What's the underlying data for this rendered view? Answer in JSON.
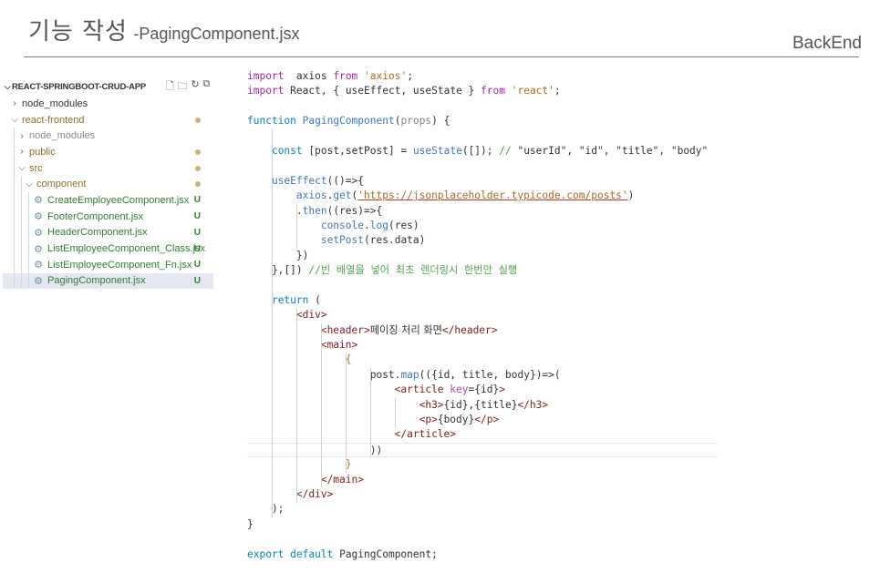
{
  "slide": {
    "title": "기능 작성",
    "subtitle": "-PagingComponent.jsx",
    "category": "BackEnd"
  },
  "explorer": {
    "project": "REACT-SPRINGBOOT-CRUD-APP",
    "items": [
      {
        "label": "node_modules",
        "indent": 1,
        "type": "folder",
        "expanded": false,
        "color": "default",
        "status": ""
      },
      {
        "label": "react-frontend",
        "indent": 1,
        "type": "folder",
        "expanded": true,
        "color": "olive",
        "status": "dot"
      },
      {
        "label": "node_modules",
        "indent": 2,
        "type": "folder",
        "expanded": false,
        "color": "gray",
        "status": ""
      },
      {
        "label": "public",
        "indent": 2,
        "type": "folder",
        "expanded": false,
        "color": "olive",
        "status": "dot"
      },
      {
        "label": "src",
        "indent": 2,
        "type": "folder",
        "expanded": true,
        "color": "olive",
        "status": "dot"
      },
      {
        "label": "component",
        "indent": 3,
        "type": "folder",
        "expanded": true,
        "color": "olive",
        "status": "dot"
      },
      {
        "label": "CreateEmployeeComponent.jsx",
        "indent": 4,
        "type": "file",
        "color": "green",
        "status": "U"
      },
      {
        "label": "FooterComponent.jsx",
        "indent": 4,
        "type": "file",
        "color": "green",
        "status": "U"
      },
      {
        "label": "HeaderComponent.jsx",
        "indent": 4,
        "type": "file",
        "color": "green",
        "status": "U"
      },
      {
        "label": "ListEmployeeComponent_Class.jsx",
        "indent": 4,
        "type": "file",
        "color": "green",
        "status": "U"
      },
      {
        "label": "ListEmployeeComponent_Fn.jsx",
        "indent": 4,
        "type": "file",
        "color": "green",
        "status": "U"
      },
      {
        "label": "PagingComponent.jsx",
        "indent": 4,
        "type": "file",
        "color": "green",
        "status": "U",
        "selected": true
      }
    ]
  },
  "code": {
    "lines": [
      [
        [
          "kw",
          "import"
        ],
        [
          "",
          "  "
        ],
        [
          "var",
          "axios"
        ],
        [
          "",
          " "
        ],
        [
          "kw",
          "from"
        ],
        [
          "",
          " "
        ],
        [
          "str",
          "'axios'"
        ],
        [
          "",
          ";"
        ]
      ],
      [
        [
          "kw",
          "import"
        ],
        [
          "",
          " "
        ],
        [
          "var",
          "React"
        ],
        [
          "",
          ", { "
        ],
        [
          "var",
          "useEffect"
        ],
        [
          "",
          ", "
        ],
        [
          "var",
          "useState"
        ],
        [
          "",
          " } "
        ],
        [
          "kw",
          "from"
        ],
        [
          "",
          " "
        ],
        [
          "str",
          "'react'"
        ],
        [
          "",
          ";"
        ]
      ],
      [],
      [
        [
          "kw2",
          "function"
        ],
        [
          "",
          " "
        ],
        [
          "fn",
          "PagingComponent"
        ],
        [
          "",
          "("
        ],
        [
          "prop",
          "props"
        ],
        [
          "",
          ") {"
        ]
      ],
      [],
      [
        [
          "",
          "    "
        ],
        [
          "kw2",
          "const"
        ],
        [
          "",
          " ["
        ],
        [
          "var",
          "post"
        ],
        [
          "",
          ","
        ],
        [
          "var",
          "setPost"
        ],
        [
          "",
          "] = "
        ],
        [
          "fn",
          "useState"
        ],
        [
          "",
          "([]); "
        ],
        [
          "cmt",
          "// "
        ],
        [
          "",
          "\"userId\", \"id\", \"title\", \"body\""
        ]
      ],
      [],
      [
        [
          "",
          "    "
        ],
        [
          "fn",
          "useEffect"
        ],
        [
          "",
          "(()=>{"
        ]
      ],
      [
        [
          "",
          "        "
        ],
        [
          "fn",
          "axios"
        ],
        [
          "",
          "."
        ],
        [
          "fn",
          "get"
        ],
        [
          "",
          "("
        ],
        [
          "url",
          "'https://jsonplaceholder.typicode.com/posts'"
        ],
        [
          "",
          ")"
        ]
      ],
      [
        [
          "",
          "        ."
        ],
        [
          "fn",
          "then"
        ],
        [
          "",
          "(("
        ],
        [
          "var",
          "res"
        ],
        [
          "",
          ")=>{"
        ]
      ],
      [
        [
          "",
          "            "
        ],
        [
          "fn",
          "console"
        ],
        [
          "",
          "."
        ],
        [
          "fn",
          "log"
        ],
        [
          "",
          "("
        ],
        [
          "var",
          "res"
        ],
        [
          "",
          ")"
        ]
      ],
      [
        [
          "",
          "            "
        ],
        [
          "fn",
          "setPost"
        ],
        [
          "",
          "("
        ],
        [
          "var",
          "res"
        ],
        [
          "",
          "."
        ],
        [
          "var",
          "data"
        ],
        [
          "",
          ")"
        ]
      ],
      [
        [
          "",
          "        })"
        ]
      ],
      [
        [
          "",
          "    },[]) "
        ],
        [
          "cmt",
          "//빈 배열을 넣어 최초 렌더링시 한번만 실행"
        ]
      ],
      [],
      [
        [
          "",
          "    "
        ],
        [
          "kw2",
          "return"
        ],
        [
          "",
          " ("
        ]
      ],
      [
        [
          "",
          "        "
        ],
        [
          "tag",
          "<div>"
        ]
      ],
      [
        [
          "",
          "            "
        ],
        [
          "tag",
          "<header>"
        ],
        [
          "korean",
          "페이징 처리 화면"
        ],
        [
          "tag",
          "</header>"
        ]
      ],
      [
        [
          "",
          "            "
        ],
        [
          "tag",
          "<main>"
        ]
      ],
      [
        [
          "",
          "                "
        ],
        [
          "brk",
          "{"
        ]
      ],
      [
        [
          "",
          "                    "
        ],
        [
          "var",
          "post"
        ],
        [
          "",
          "."
        ],
        [
          "fn",
          "map"
        ],
        [
          "",
          "(({"
        ],
        [
          "var",
          "id"
        ],
        [
          "",
          ", "
        ],
        [
          "var",
          "title"
        ],
        [
          "",
          ", "
        ],
        [
          "var",
          "body"
        ],
        [
          "",
          "})=>("
        ]
      ],
      [
        [
          "",
          "                        "
        ],
        [
          "tag",
          "<article "
        ],
        [
          "attr",
          "key"
        ],
        [
          "",
          "={"
        ],
        [
          "var",
          "id"
        ],
        [
          "",
          "}"
        ],
        [
          "tag",
          ">"
        ]
      ],
      [
        [
          "",
          "                            "
        ],
        [
          "tag",
          "<h3>"
        ],
        [
          "",
          "{"
        ],
        [
          "var",
          "id"
        ],
        [
          "",
          "},{"
        ],
        [
          "var",
          "title"
        ],
        [
          "",
          "}"
        ],
        [
          "tag",
          "</h3>"
        ]
      ],
      [
        [
          "",
          "                            "
        ],
        [
          "tag",
          "<p>"
        ],
        [
          "",
          "{"
        ],
        [
          "var",
          "body"
        ],
        [
          "",
          "}"
        ],
        [
          "tag",
          "</p>"
        ]
      ],
      [
        [
          "",
          "                        "
        ],
        [
          "tag",
          "</article>"
        ]
      ],
      [
        [
          "",
          "                    ))"
        ]
      ],
      [
        [
          "",
          "                "
        ],
        [
          "brk",
          "}"
        ]
      ],
      [
        [
          "",
          "            "
        ],
        [
          "tag",
          "</main>"
        ]
      ],
      [
        [
          "",
          "        "
        ],
        [
          "tag",
          "</div>"
        ]
      ],
      [
        [
          "",
          "    );"
        ]
      ],
      [
        [
          "",
          "}"
        ]
      ],
      [],
      [
        [
          "kw2",
          "export"
        ],
        [
          "",
          " "
        ],
        [
          "kw2",
          "default"
        ],
        [
          "",
          " "
        ],
        [
          "var",
          "PagingComponent"
        ],
        [
          "",
          ";"
        ]
      ]
    ],
    "current_line": 25
  }
}
